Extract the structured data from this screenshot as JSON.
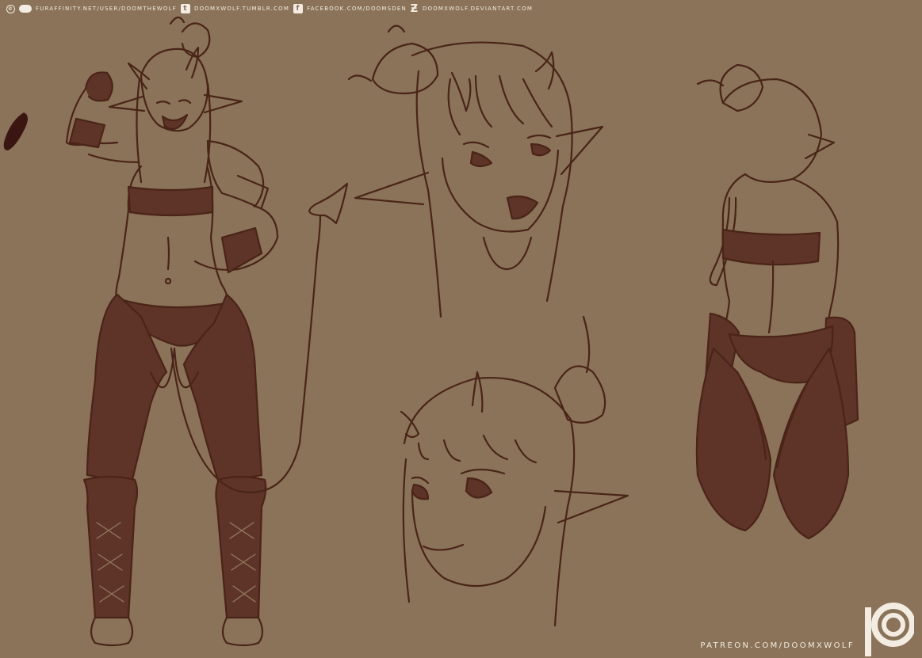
{
  "credits": {
    "furaffinity": "FURAFFINITY.NET/USER/DOOMTHEWOLF",
    "tumblr": "DOOMXWOLF.TUMBLR.COM",
    "facebook": "FACEBOOK.COM/DOOMSDEN",
    "deviantart": "DOOMXWOLF.DEVIANTART.COM"
  },
  "icons": {
    "copyright": "copyright-icon",
    "furaffinity": "furaffinity-icon",
    "tumblr": "tumblr-icon",
    "facebook": "facebook-icon",
    "deviantart": "deviantart-icon",
    "patreon": "patreon-logo-icon"
  },
  "patreon": {
    "url": "PATREON.COM/DOOMXWOLF"
  },
  "colors": {
    "background": "#8a7358",
    "line": "#4a2418",
    "fill": "#5e3328",
    "text": "#f3ece2"
  }
}
